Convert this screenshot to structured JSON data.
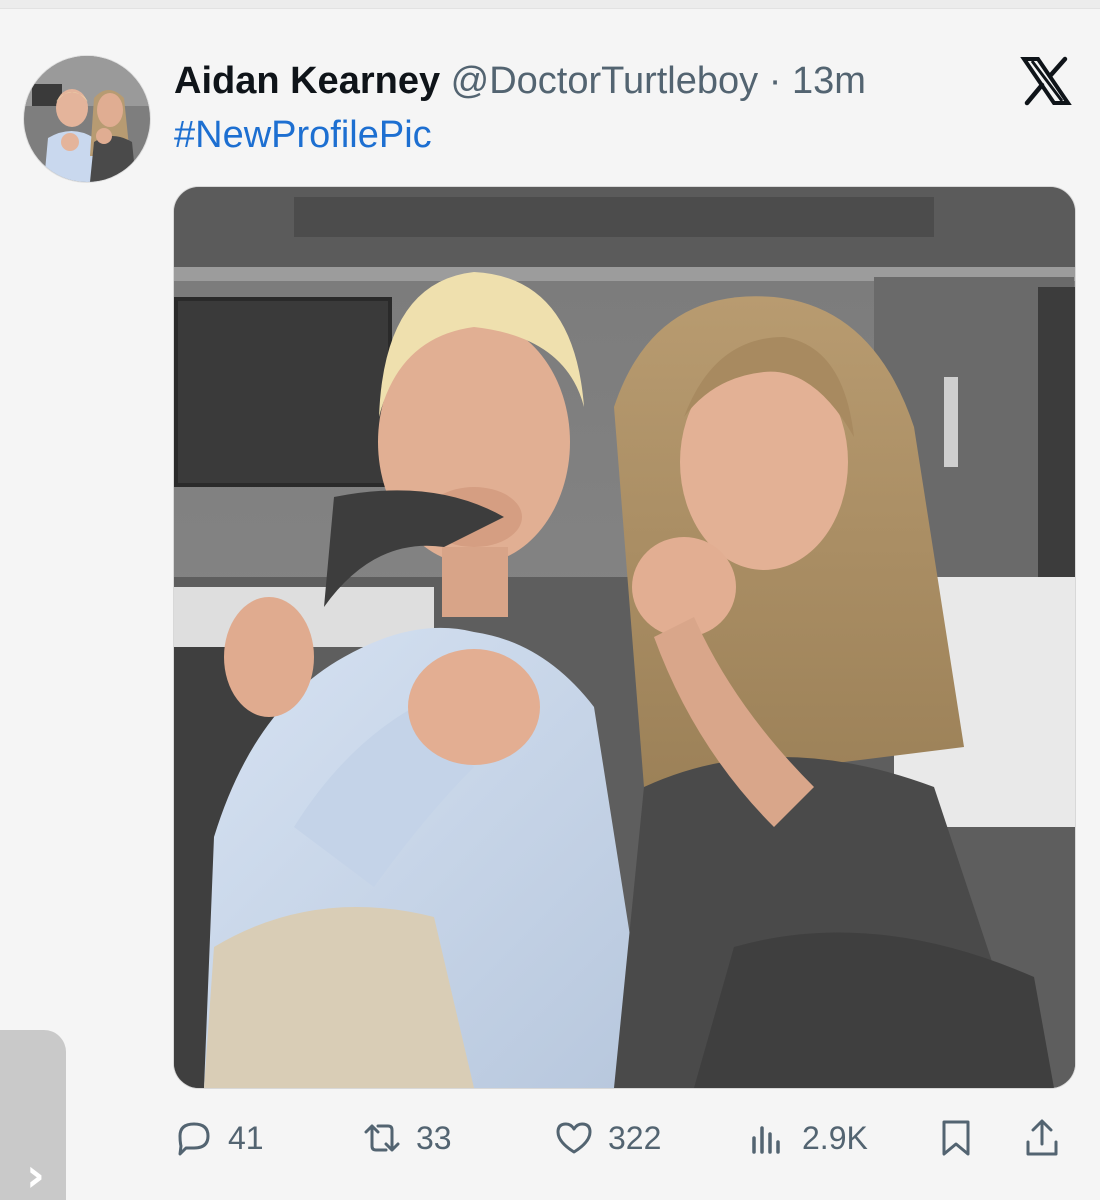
{
  "tweet": {
    "author_name": "Aidan Kearney",
    "handle": "@DoctorTurtleboy",
    "separator": "·",
    "time": "13m",
    "text": "#NewProfilePic",
    "platform_icon": "x-logo-icon",
    "avatar_icon": "avatar-photo",
    "image_icon": "attached-photo"
  },
  "actions": {
    "replies": "41",
    "reposts": "33",
    "likes": "322",
    "views": "2.9K",
    "icons": [
      "reply-icon",
      "repost-icon",
      "like-icon",
      "views-icon",
      "bookmark-icon",
      "share-icon"
    ]
  },
  "side": {
    "chevron": "›"
  },
  "colors": {
    "name": "#0f1419",
    "meta": "#536471",
    "hashtag": "#1d6fd1",
    "background": "#f5f5f5"
  }
}
